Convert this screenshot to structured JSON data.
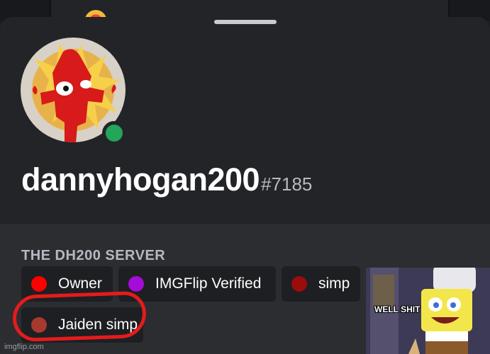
{
  "profile": {
    "username": "dannyhogan200",
    "discriminator": "#7185",
    "status": "online",
    "status_color": "#23a55a",
    "avatar_icon": "red-cartoon-character-avatar"
  },
  "server": {
    "name": "THE DH200 SERVER",
    "roles": [
      {
        "label": "Owner",
        "color": "#ff0000"
      },
      {
        "label": "IMGFlip Verified",
        "color": "#a50bd9"
      },
      {
        "label": "simp",
        "color": "#9b0c0c"
      },
      {
        "label": "Jaiden simp",
        "color": "#a63a2e"
      }
    ]
  },
  "meme_overlay": {
    "caption": "WELL SHIT",
    "icon": "spongebob-meme-image"
  },
  "annotation": {
    "color": "#e51b1b",
    "target": "Jaiden simp"
  },
  "watermark": "imgflip.com",
  "colors": {
    "background": "#1e1f22",
    "sheet": "#232428",
    "roles_panel": "#2b2d31",
    "role_pill": "#1e1f22",
    "muted_text": "#b5bac1"
  }
}
